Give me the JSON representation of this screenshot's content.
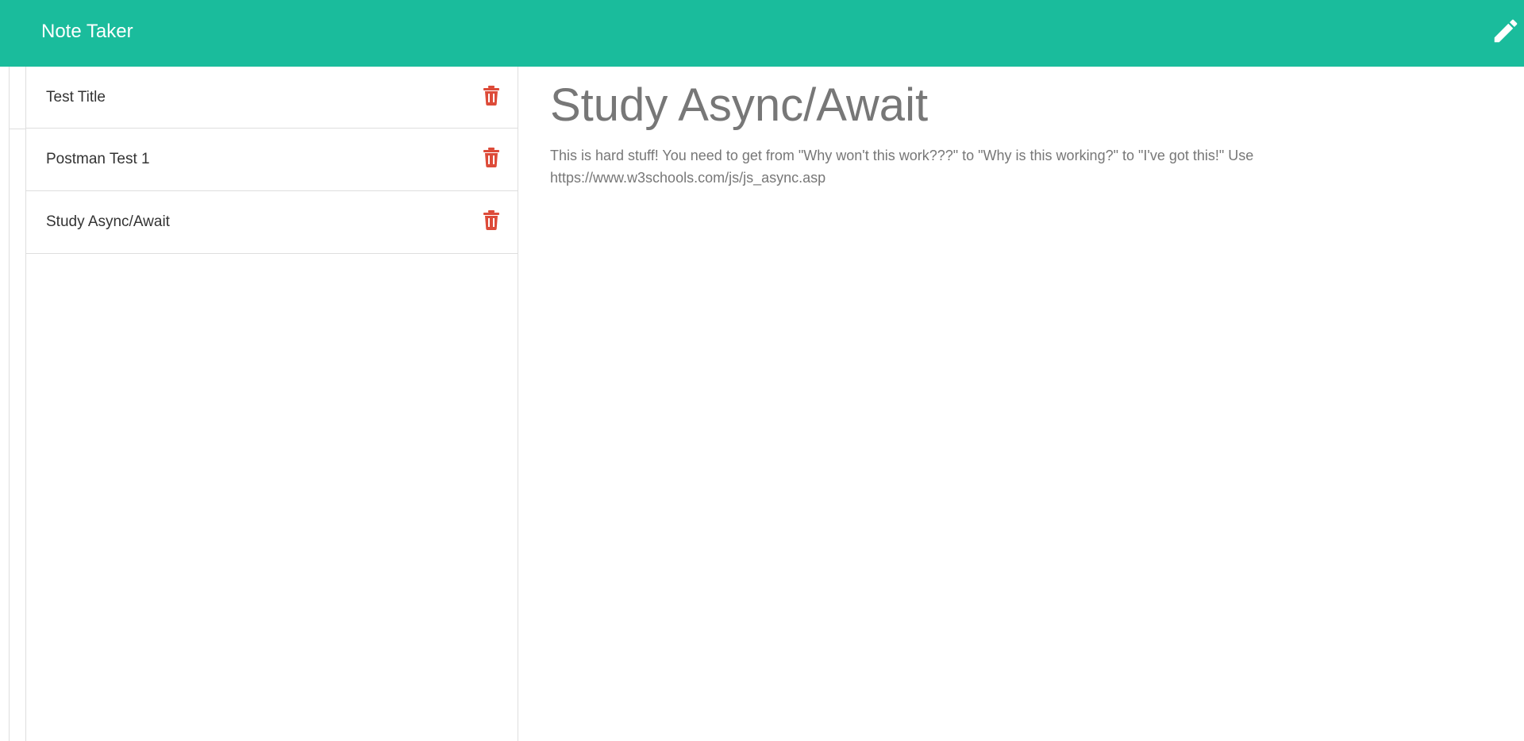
{
  "app": {
    "brand": "Note Taker",
    "accent_color": "#1abc9c",
    "delete_color": "#dd4b39",
    "new_note_icon": "pencil-icon"
  },
  "notes": [
    {
      "title": "Test Title",
      "delete_icon": "trash-icon"
    },
    {
      "title": "Postman Test 1",
      "delete_icon": "trash-icon"
    },
    {
      "title": "Study Async/Await",
      "delete_icon": "trash-icon"
    }
  ],
  "active_note": {
    "title": "Study Async/Await",
    "text": "This is hard stuff! You need to get from \"Why won't this work???\" to \"Why is this working?\" to \"I've got this!\" Use https://www.w3schools.com/js/js_async.asp"
  }
}
